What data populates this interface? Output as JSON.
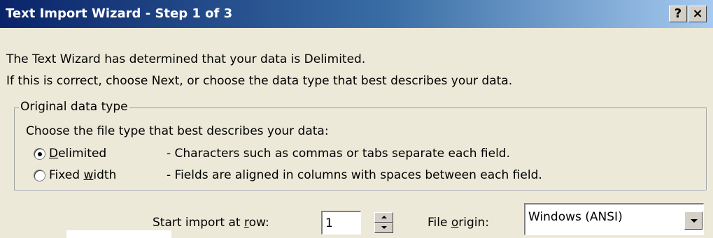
{
  "window": {
    "title": "Text Import Wizard - Step 1 of 3",
    "help_label": "?",
    "close_label": "×"
  },
  "message": {
    "line1": "The Text Wizard has determined that your data is Delimited.",
    "line2": "If this is correct, choose Next, or choose the data type that best describes your data."
  },
  "group": {
    "label": "Original data type",
    "instruction": "Choose the file type that best describes your data:",
    "options": [
      {
        "label_pre": "",
        "label_ul": "D",
        "label_post": "elimited",
        "description": "- Characters such as commas or tabs separate each field.",
        "selected": true
      },
      {
        "label_pre": "Fixed ",
        "label_ul": "w",
        "label_post": "idth",
        "description": "- Fields are aligned in columns with spaces between each field.",
        "selected": false
      }
    ]
  },
  "start_row": {
    "label_pre": "Start import at ",
    "label_ul": "r",
    "label_post": "ow:",
    "value": "1"
  },
  "file_origin": {
    "label_pre": "File ",
    "label_ul": "o",
    "label_post": "rigin:",
    "value": "Windows (ANSI)"
  },
  "colors": {
    "dialog_bg": "#ece9d8",
    "title_start": "#0a246a",
    "title_end": "#a6caf0"
  }
}
